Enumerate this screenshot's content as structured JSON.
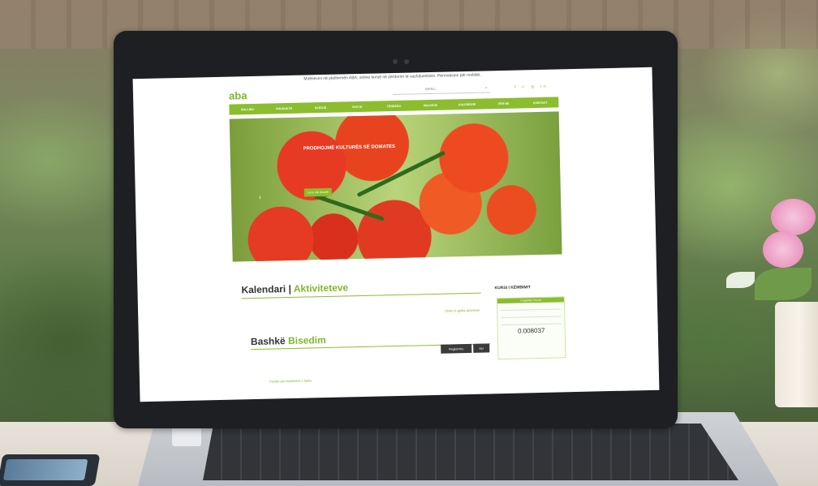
{
  "website": {
    "top_message": "Mirësevini në platformën ABA, online borsë në përdorim të vazhdueshëm. Përmirësimi për mobilët.",
    "logo": "aba",
    "search_placeholder": "Kërko...",
    "nav": [
      "BALLINA",
      "PRODUKTE",
      "BLERJE",
      "SHITJE",
      "TENDERA",
      "NGJARJE",
      "KALENDARI",
      "PËR NE",
      "KONTAKT"
    ],
    "hero": {
      "title": "PRODHOJMË KULTURËS SË DOMATES",
      "text": "",
      "button": "Lexo më shumë"
    },
    "calendar": {
      "title": "Kalendari",
      "title_accent": "Aktiviteteve",
      "link": "Shiko të gjitha aktivitetet"
    },
    "chat": {
      "title": "Bashkë",
      "title_accent": "Bisedim",
      "login_button": "Regjistrohu",
      "new_button": "Hyr",
      "footer_link": "Pyetjet për bashkimin e fjalës"
    },
    "exchange": {
      "title": "KURSI I KËMBIMIT",
      "header": "Llogaritës i kursit",
      "value": "0.008037"
    }
  }
}
